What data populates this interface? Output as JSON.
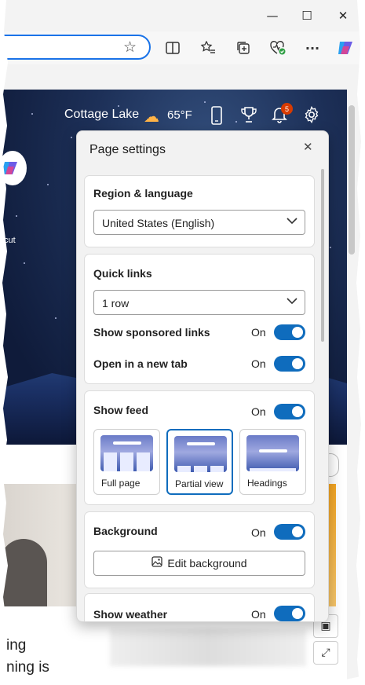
{
  "window": {
    "minimize_glyph": "—",
    "maximize_glyph": "☐",
    "close_glyph": "✕"
  },
  "toolbar": {
    "icons": [
      "split-screen-icon",
      "favorites-icon",
      "collections-icon",
      "browser-essentials-icon",
      "more-icon",
      "copilot-icon"
    ],
    "more_glyph": "···"
  },
  "header": {
    "location": "Cottage Lake",
    "temperature": "65°F",
    "notification_count": "5"
  },
  "hero": {
    "shortcut_label_fragment": "tcut"
  },
  "panel": {
    "title": "Page settings",
    "close_glyph": "✕",
    "region": {
      "title": "Region & language",
      "selected": "United States (English)"
    },
    "quick_links": {
      "title": "Quick links",
      "selected": "1 row",
      "sponsored_label": "Show sponsored links",
      "sponsored_state": "On",
      "new_tab_label": "Open in a new tab",
      "new_tab_state": "On"
    },
    "feed": {
      "title": "Show feed",
      "state": "On",
      "layouts": [
        {
          "label": "Full page",
          "selected": false
        },
        {
          "label": "Partial view",
          "selected": true
        },
        {
          "label": "Headings",
          "selected": false
        }
      ]
    },
    "background": {
      "title": "Background",
      "state": "On",
      "edit_label": "Edit background"
    },
    "weather": {
      "title": "Show weather",
      "state": "On"
    }
  },
  "page": {
    "article_line1": "ing",
    "article_line2": "ning is"
  },
  "colors": {
    "accent": "#0f6cbd",
    "badge": "#d83b01",
    "address_focus": "#1a73e8"
  }
}
